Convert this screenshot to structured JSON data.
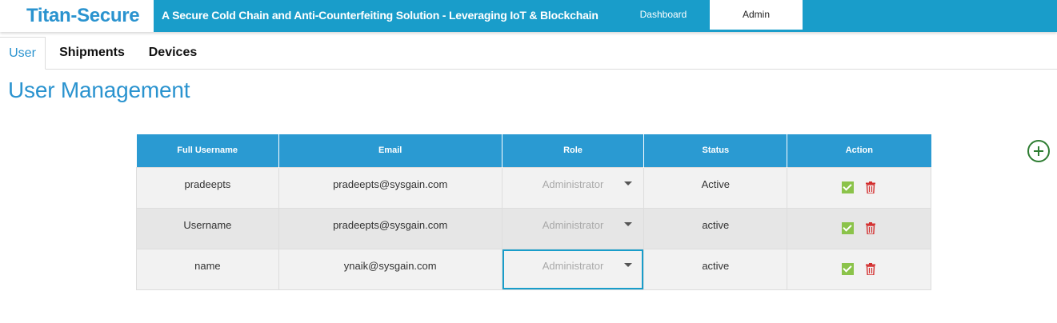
{
  "header": {
    "brand": "Titan-Secure",
    "tagline": "A Secure Cold Chain and Anti-Counterfeiting Solution - Leveraging IoT & Blockchain",
    "nav": {
      "dashboard": "Dashboard",
      "admin": "Admin"
    },
    "accent_color": "#199dca"
  },
  "tabs": {
    "user": "User",
    "shipments": "Shipments",
    "devices": "Devices"
  },
  "page_title": "User Management",
  "table": {
    "columns": [
      "Full Username",
      "Email",
      "Role",
      "Status",
      "Action"
    ],
    "rows": [
      {
        "username": "pradeepts",
        "email": "pradeepts@sysgain.com",
        "role": "Administrator",
        "status": "Active"
      },
      {
        "username": "Username",
        "email": "pradeepts@sysgain.com",
        "role": "Administrator",
        "status": "active"
      },
      {
        "username": "name",
        "email": "ynaik@sysgain.com",
        "role": "Administrator",
        "status": "active"
      }
    ]
  },
  "icons": {
    "add": "plus-circle-icon",
    "approve": "check-square-icon",
    "delete": "trash-icon",
    "dropdown": "caret-down-icon"
  }
}
